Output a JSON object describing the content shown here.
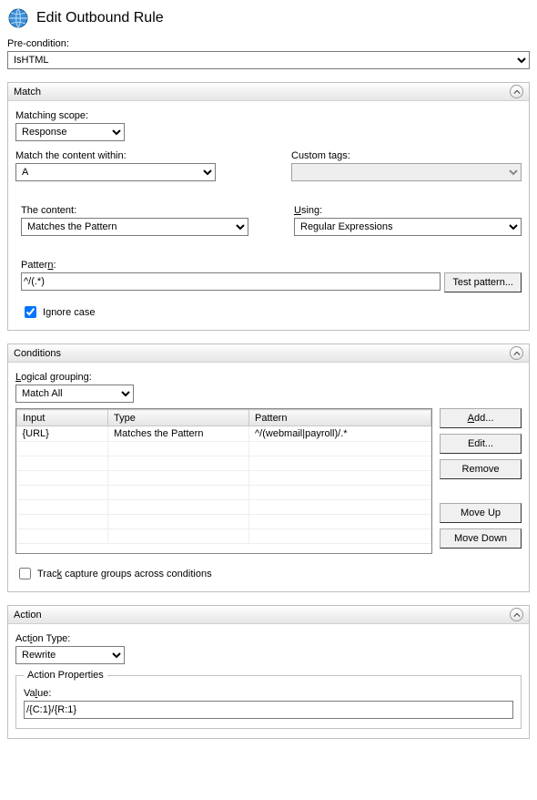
{
  "header": {
    "title": "Edit Outbound Rule"
  },
  "precondition": {
    "label": "Pre-condition:",
    "value": "IsHTML"
  },
  "match": {
    "title": "Match",
    "scope_label": "Matching scope:",
    "scope_value": "Response",
    "content_within_label": "Match the content within:",
    "content_within_value": "A",
    "custom_tags_label": "Custom tags:",
    "custom_tags_value": "",
    "content_label": "The content:",
    "content_value": "Matches the Pattern",
    "using_label": "Using:",
    "using_value": "Regular Expressions",
    "pattern_label": "Pattern:",
    "pattern_value": "^/(.*)",
    "test_button": "Test pattern...",
    "ignore_case_label": "Ignore case",
    "ignore_case_checked": true
  },
  "conditions": {
    "title": "Conditions",
    "logical_label": "Logical grouping:",
    "logical_value": "Match All",
    "columns": {
      "input": "Input",
      "type": "Type",
      "pattern": "Pattern"
    },
    "rows": [
      {
        "input": "{URL}",
        "type": "Matches the Pattern",
        "pattern": "^/(webmail|payroll)/.*"
      }
    ],
    "buttons": {
      "add": "Add...",
      "edit": "Edit...",
      "remove": "Remove",
      "move_up": "Move Up",
      "move_down": "Move Down"
    },
    "track_label": "Track capture groups across conditions",
    "track_checked": false
  },
  "action": {
    "title": "Action",
    "type_label": "Action Type:",
    "type_value": "Rewrite",
    "properties_legend": "Action Properties",
    "value_label": "Value:",
    "value": "/{C:1}/{R:1}"
  }
}
